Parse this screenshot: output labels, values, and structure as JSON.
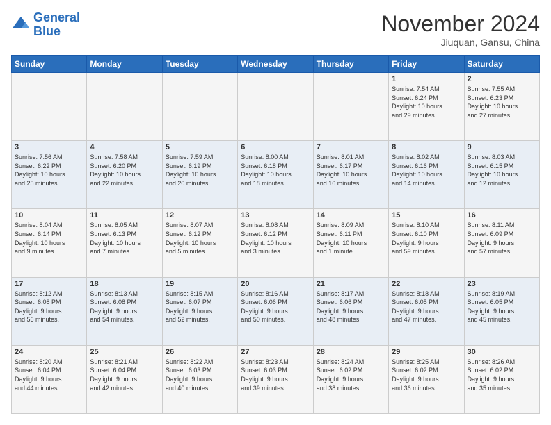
{
  "header": {
    "logo_line1": "General",
    "logo_line2": "Blue",
    "month": "November 2024",
    "location": "Jiuquan, Gansu, China"
  },
  "days_of_week": [
    "Sunday",
    "Monday",
    "Tuesday",
    "Wednesday",
    "Thursday",
    "Friday",
    "Saturday"
  ],
  "weeks": [
    [
      {
        "day": "",
        "info": ""
      },
      {
        "day": "",
        "info": ""
      },
      {
        "day": "",
        "info": ""
      },
      {
        "day": "",
        "info": ""
      },
      {
        "day": "",
        "info": ""
      },
      {
        "day": "1",
        "info": "Sunrise: 7:54 AM\nSunset: 6:24 PM\nDaylight: 10 hours\nand 29 minutes."
      },
      {
        "day": "2",
        "info": "Sunrise: 7:55 AM\nSunset: 6:23 PM\nDaylight: 10 hours\nand 27 minutes."
      }
    ],
    [
      {
        "day": "3",
        "info": "Sunrise: 7:56 AM\nSunset: 6:22 PM\nDaylight: 10 hours\nand 25 minutes."
      },
      {
        "day": "4",
        "info": "Sunrise: 7:58 AM\nSunset: 6:20 PM\nDaylight: 10 hours\nand 22 minutes."
      },
      {
        "day": "5",
        "info": "Sunrise: 7:59 AM\nSunset: 6:19 PM\nDaylight: 10 hours\nand 20 minutes."
      },
      {
        "day": "6",
        "info": "Sunrise: 8:00 AM\nSunset: 6:18 PM\nDaylight: 10 hours\nand 18 minutes."
      },
      {
        "day": "7",
        "info": "Sunrise: 8:01 AM\nSunset: 6:17 PM\nDaylight: 10 hours\nand 16 minutes."
      },
      {
        "day": "8",
        "info": "Sunrise: 8:02 AM\nSunset: 6:16 PM\nDaylight: 10 hours\nand 14 minutes."
      },
      {
        "day": "9",
        "info": "Sunrise: 8:03 AM\nSunset: 6:15 PM\nDaylight: 10 hours\nand 12 minutes."
      }
    ],
    [
      {
        "day": "10",
        "info": "Sunrise: 8:04 AM\nSunset: 6:14 PM\nDaylight: 10 hours\nand 9 minutes."
      },
      {
        "day": "11",
        "info": "Sunrise: 8:05 AM\nSunset: 6:13 PM\nDaylight: 10 hours\nand 7 minutes."
      },
      {
        "day": "12",
        "info": "Sunrise: 8:07 AM\nSunset: 6:12 PM\nDaylight: 10 hours\nand 5 minutes."
      },
      {
        "day": "13",
        "info": "Sunrise: 8:08 AM\nSunset: 6:12 PM\nDaylight: 10 hours\nand 3 minutes."
      },
      {
        "day": "14",
        "info": "Sunrise: 8:09 AM\nSunset: 6:11 PM\nDaylight: 10 hours\nand 1 minute."
      },
      {
        "day": "15",
        "info": "Sunrise: 8:10 AM\nSunset: 6:10 PM\nDaylight: 9 hours\nand 59 minutes."
      },
      {
        "day": "16",
        "info": "Sunrise: 8:11 AM\nSunset: 6:09 PM\nDaylight: 9 hours\nand 57 minutes."
      }
    ],
    [
      {
        "day": "17",
        "info": "Sunrise: 8:12 AM\nSunset: 6:08 PM\nDaylight: 9 hours\nand 56 minutes."
      },
      {
        "day": "18",
        "info": "Sunrise: 8:13 AM\nSunset: 6:08 PM\nDaylight: 9 hours\nand 54 minutes."
      },
      {
        "day": "19",
        "info": "Sunrise: 8:15 AM\nSunset: 6:07 PM\nDaylight: 9 hours\nand 52 minutes."
      },
      {
        "day": "20",
        "info": "Sunrise: 8:16 AM\nSunset: 6:06 PM\nDaylight: 9 hours\nand 50 minutes."
      },
      {
        "day": "21",
        "info": "Sunrise: 8:17 AM\nSunset: 6:06 PM\nDaylight: 9 hours\nand 48 minutes."
      },
      {
        "day": "22",
        "info": "Sunrise: 8:18 AM\nSunset: 6:05 PM\nDaylight: 9 hours\nand 47 minutes."
      },
      {
        "day": "23",
        "info": "Sunrise: 8:19 AM\nSunset: 6:05 PM\nDaylight: 9 hours\nand 45 minutes."
      }
    ],
    [
      {
        "day": "24",
        "info": "Sunrise: 8:20 AM\nSunset: 6:04 PM\nDaylight: 9 hours\nand 44 minutes."
      },
      {
        "day": "25",
        "info": "Sunrise: 8:21 AM\nSunset: 6:04 PM\nDaylight: 9 hours\nand 42 minutes."
      },
      {
        "day": "26",
        "info": "Sunrise: 8:22 AM\nSunset: 6:03 PM\nDaylight: 9 hours\nand 40 minutes."
      },
      {
        "day": "27",
        "info": "Sunrise: 8:23 AM\nSunset: 6:03 PM\nDaylight: 9 hours\nand 39 minutes."
      },
      {
        "day": "28",
        "info": "Sunrise: 8:24 AM\nSunset: 6:02 PM\nDaylight: 9 hours\nand 38 minutes."
      },
      {
        "day": "29",
        "info": "Sunrise: 8:25 AM\nSunset: 6:02 PM\nDaylight: 9 hours\nand 36 minutes."
      },
      {
        "day": "30",
        "info": "Sunrise: 8:26 AM\nSunset: 6:02 PM\nDaylight: 9 hours\nand 35 minutes."
      }
    ]
  ]
}
